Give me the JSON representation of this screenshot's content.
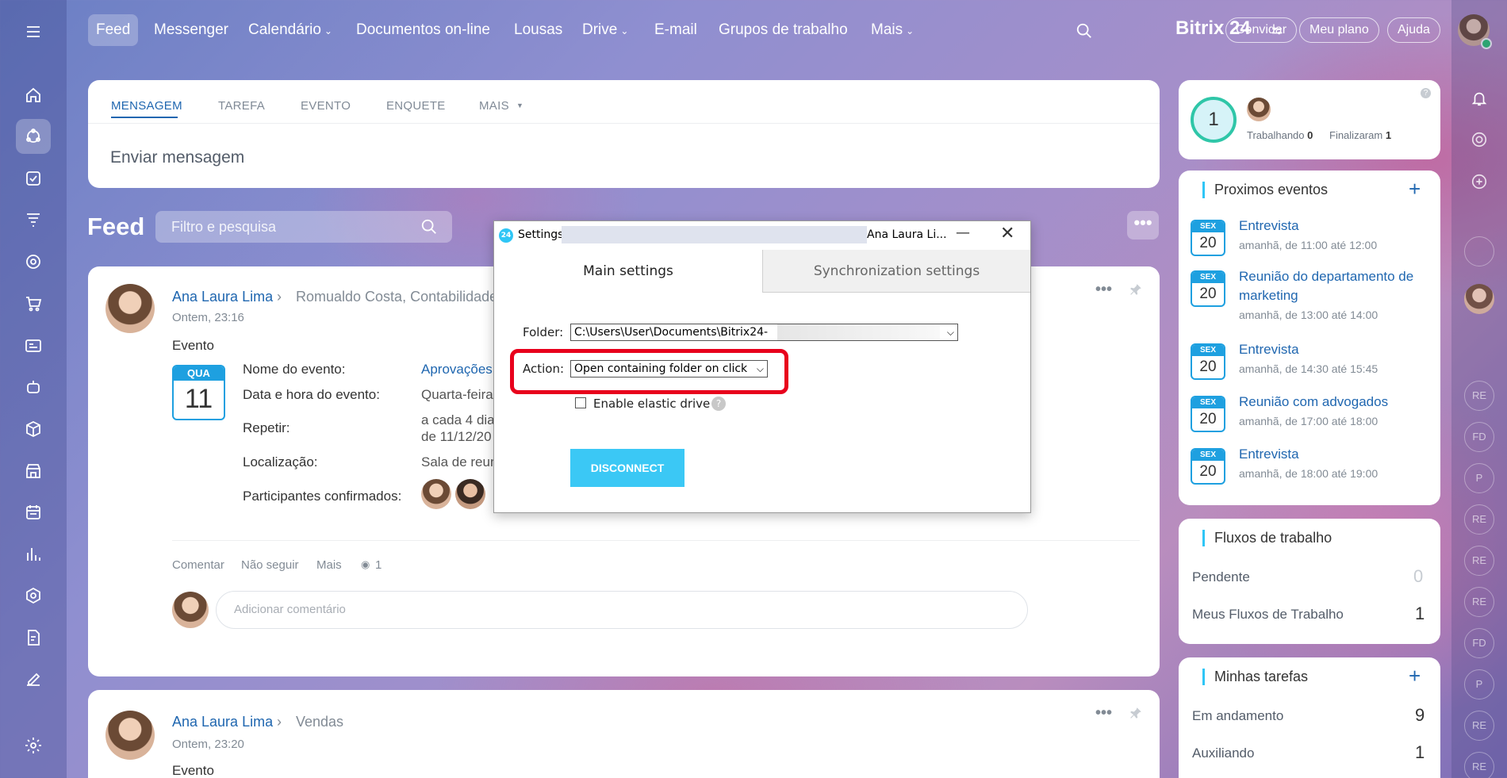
{
  "nav": {
    "items": [
      "Feed",
      "Messenger",
      "Calendário",
      "Documentos on-line",
      "Lousas",
      "Drive",
      "E-mail",
      "Grupos de trabalho",
      "Mais"
    ],
    "brand": "Bitrix 24",
    "invite": "Convidar",
    "plan": "Meu plano",
    "help": "Ajuda"
  },
  "composer": {
    "tabs": [
      "MENSAGEM",
      "TAREFA",
      "EVENTO",
      "ENQUETE",
      "MAIS"
    ],
    "placeholder": "Enviar mensagem"
  },
  "feed": {
    "title": "Feed",
    "filter_placeholder": "Filtro e pesquisa"
  },
  "post1": {
    "author": "Ana Laura Lima",
    "targets": "Romualdo Costa, Contabilidade",
    "time": "Ontem, 23:16",
    "type": "Evento",
    "cal_day": "QUA",
    "cal_num": "11",
    "fields": [
      {
        "label": "Nome do evento:",
        "value": "Aprovações"
      },
      {
        "label": "Data e hora do evento:",
        "value": "Quarta-feira"
      },
      {
        "label": "Repetir:",
        "value": "a cada 4 dia",
        "value2": "de 11/12/20"
      },
      {
        "label": "Localização:",
        "value": "Sala de reun"
      },
      {
        "label": "Participantes confirmados:",
        "value": ""
      }
    ],
    "actions": {
      "comment": "Comentar",
      "unfollow": "Não seguir",
      "more": "Mais",
      "views": "1"
    },
    "comment_placeholder": "Adicionar comentário"
  },
  "post2": {
    "author": "Ana Laura Lima",
    "target": "Vendas",
    "time": "Ontem, 23:20",
    "type": "Evento"
  },
  "worktime": {
    "count": "1",
    "working_label": "Trabalhando",
    "working_value": "0",
    "finished_label": "Finalizaram",
    "finished_value": "1"
  },
  "events": {
    "title": "Proximos eventos",
    "items": [
      {
        "day": "SEX",
        "num": "20",
        "title": "Entrevista",
        "title2": "",
        "time": "amanhã, de 11:00 até 12:00"
      },
      {
        "day": "SEX",
        "num": "20",
        "title": "Reunião do departamento de",
        "title2": "marketing",
        "time": "amanhã, de 13:00 até 14:00"
      },
      {
        "day": "SEX",
        "num": "20",
        "title": "Entrevista",
        "title2": "",
        "time": "amanhã, de 14:30 até 15:45"
      },
      {
        "day": "SEX",
        "num": "20",
        "title": "Reunião com advogados",
        "title2": "",
        "time": "amanhã, de 17:00 até 18:00"
      },
      {
        "day": "SEX",
        "num": "20",
        "title": "Entrevista",
        "title2": "",
        "time": "amanhã, de 18:00 até 19:00"
      }
    ]
  },
  "workflows": {
    "title": "Fluxos de trabalho",
    "rows": [
      {
        "label": "Pendente",
        "value": "0"
      },
      {
        "label": "Meus Fluxos de Trabalho",
        "value": "1"
      }
    ]
  },
  "tasks": {
    "title": "Minhas tarefas",
    "rows": [
      {
        "label": "Em andamento",
        "value": "9"
      },
      {
        "label": "Auxiliando",
        "value": "1"
      }
    ]
  },
  "rrail": [
    "RE",
    "FD",
    "P",
    "RE",
    "RE",
    "RE",
    "FD",
    "P",
    "RE",
    "RE"
  ],
  "dialog": {
    "title": "Settings",
    "user": "Ana Laura Li...",
    "tab_main": "Main settings",
    "tab_sync": "Synchronization settings",
    "folder_label": "Folder:",
    "folder_value": "C:\\Users\\User\\Documents\\Bitrix24-",
    "action_label": "Action:",
    "action_value": "Open containing folder on click",
    "elastic_label": "Enable elastic drive",
    "disconnect": "DISCONNECT"
  }
}
